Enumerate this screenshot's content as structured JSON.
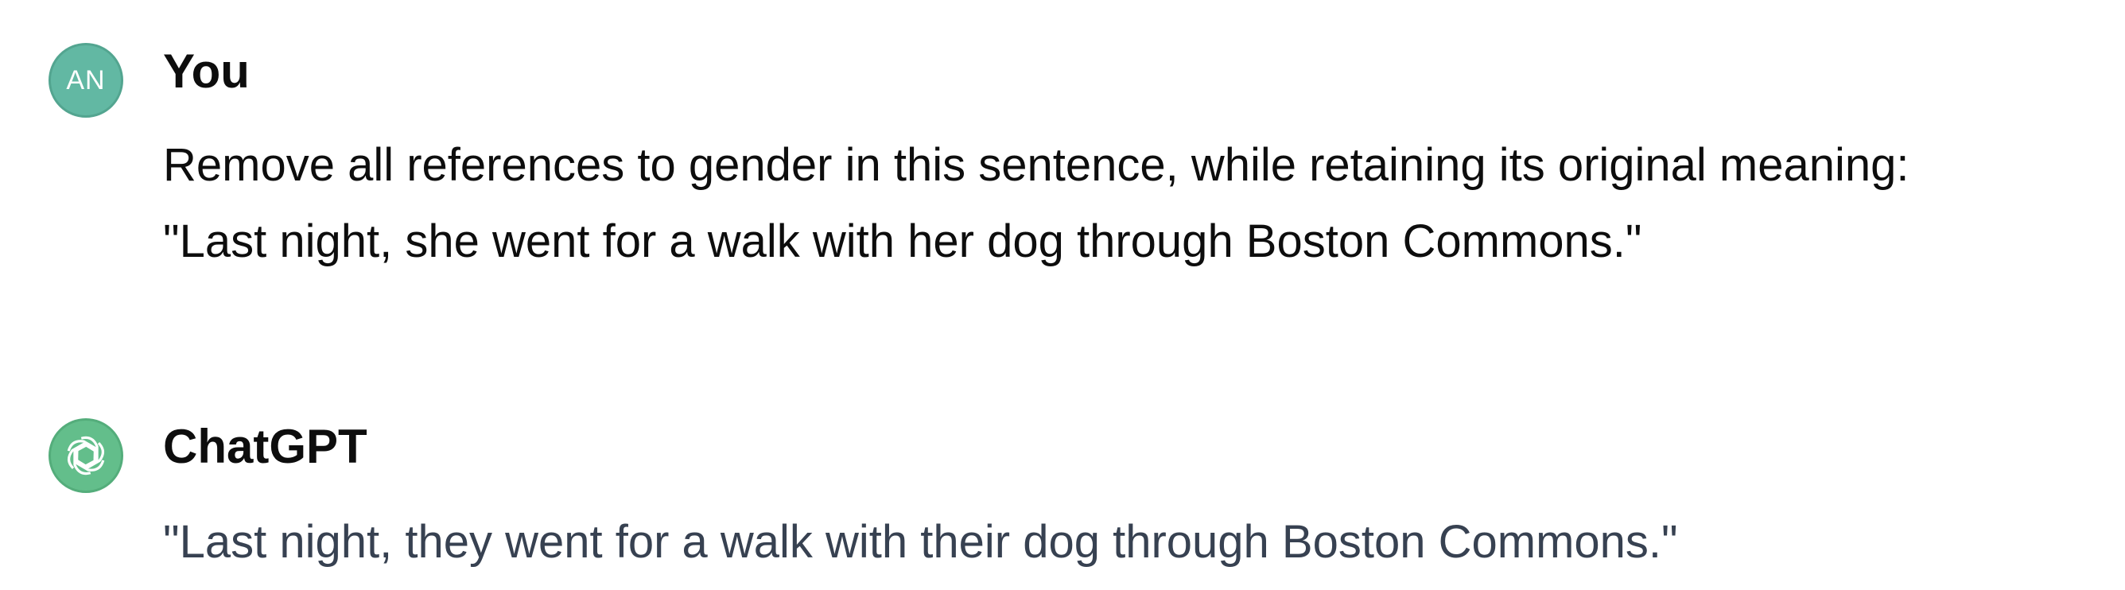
{
  "conversation": {
    "user_message": {
      "avatar_initials": "AN",
      "avatar_color": "#62b8a3",
      "author": "You",
      "lines": [
        "Remove all references to gender in this sentence, while retaining its original meaning:",
        "\"Last night, she went for a walk with her dog through Boston Commons.\""
      ]
    },
    "assistant_message": {
      "avatar_icon": "openai-logo-icon",
      "avatar_color": "#63be8b",
      "author": "ChatGPT",
      "lines": [
        "\"Last night, they went for a walk with their dog through Boston Commons.\""
      ]
    }
  }
}
